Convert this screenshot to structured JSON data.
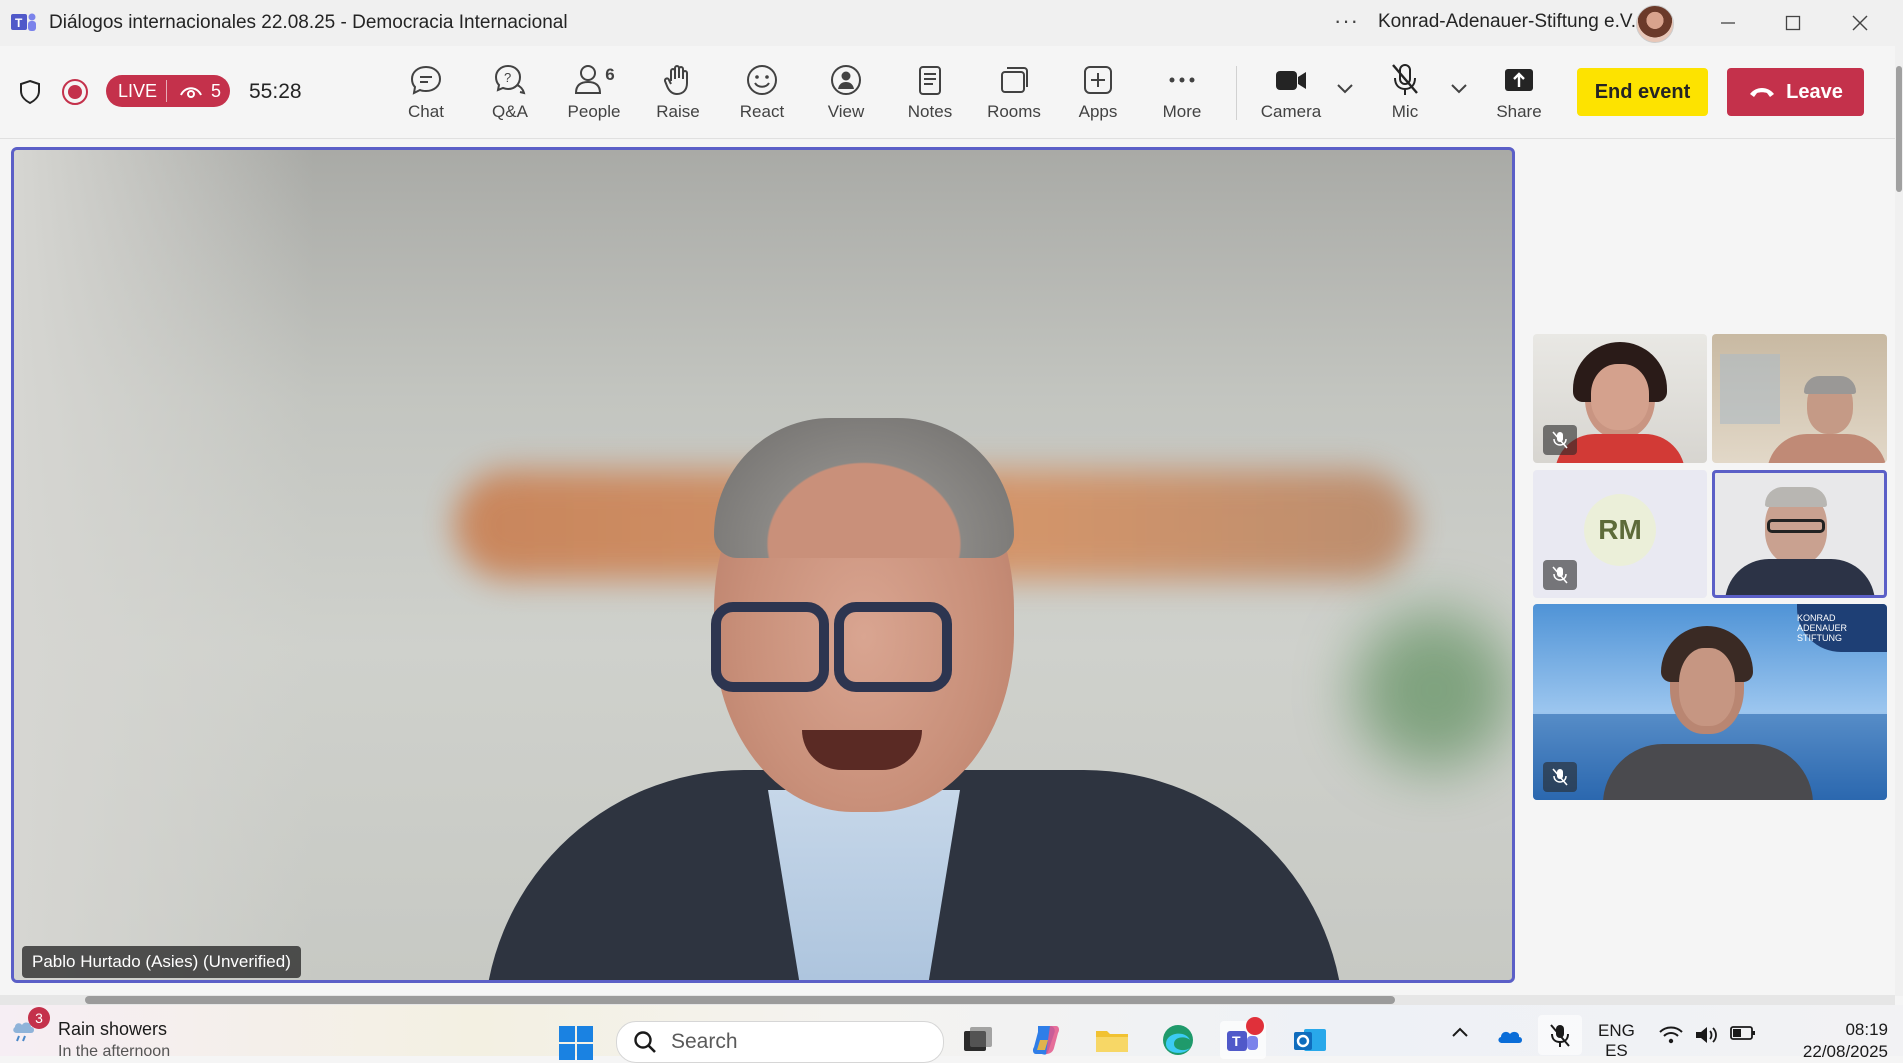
{
  "window": {
    "title": "Diálogos internacionales 22.08.25 - Democracia Internacional",
    "more_glyph": "···",
    "org": "Konrad-Adenauer-Stiftung e.V."
  },
  "toolbar": {
    "live_label": "LIVE",
    "viewer_count": "5",
    "timer": "55:28",
    "tools": {
      "chat": "Chat",
      "qa": "Q&A",
      "people": "People",
      "people_count": "6",
      "raise": "Raise",
      "react": "React",
      "view": "View",
      "notes": "Notes",
      "rooms": "Rooms",
      "apps": "Apps",
      "more": "More",
      "camera": "Camera",
      "mic": "Mic",
      "share": "Share"
    },
    "end_event": "End event",
    "leave": "Leave"
  },
  "stage": {
    "speaker_name": "Pablo Hurtado (Asies) (Unverified)",
    "participants": [
      {
        "initials": ""
      },
      {
        "initials": ""
      },
      {
        "initials": "RM"
      },
      {
        "initials": ""
      },
      {
        "initials": ""
      }
    ],
    "kas_logo": "KONRAD ADENAUER STIFTUNG"
  },
  "taskbar": {
    "weather_badge": "3",
    "weather_title": "Rain showers",
    "weather_sub": "In the afternoon",
    "search_placeholder": "Search",
    "lang_top": "ENG",
    "lang_bottom": "ES",
    "time": "08:19",
    "date": "22/08/2025"
  },
  "colors": {
    "accent": "#5b5fc7",
    "live_red": "#c4314b",
    "end_event_yellow": "#fde300"
  },
  "icons": [
    "teams-icon",
    "shield-icon",
    "record-icon",
    "eye-icon",
    "chat-icon",
    "qa-icon",
    "people-icon",
    "raise-hand-icon",
    "react-icon",
    "view-icon",
    "notes-icon",
    "rooms-icon",
    "apps-icon",
    "more-icon",
    "camera-icon",
    "mic-off-icon",
    "share-icon",
    "phone-icon",
    "windows-start-icon",
    "search-icon"
  ]
}
